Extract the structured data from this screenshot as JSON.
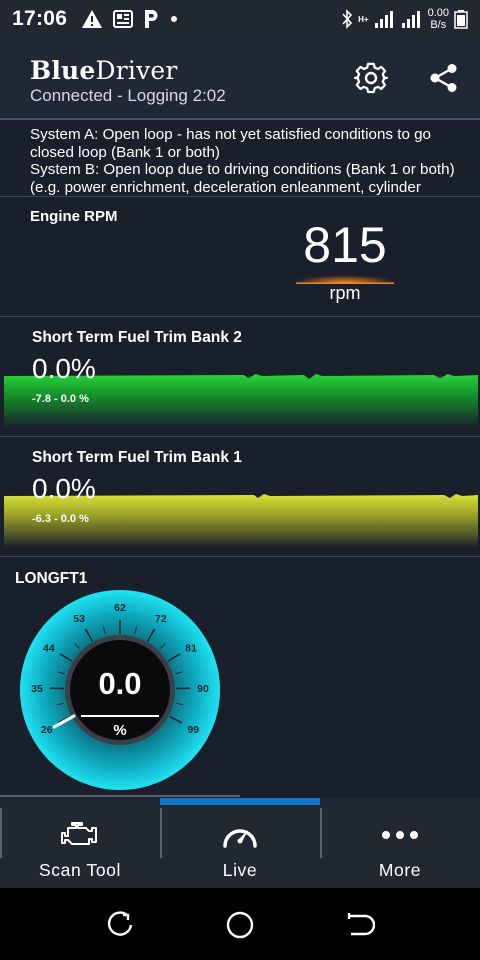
{
  "status_bar": {
    "time": "17:06",
    "left_icons": [
      "warning-icon",
      "news-icon",
      "parking-icon",
      "dot-icon"
    ],
    "network_label": "H+",
    "speed_value": "0.00",
    "speed_unit": "B/s"
  },
  "header": {
    "brand_bold": "Blue",
    "brand_rest": "Driver",
    "subtitle": "Connected - Logging 2:02",
    "settings_icon": "gear-icon",
    "share_icon": "share-icon"
  },
  "system_status": {
    "line_a": "System A: Open loop - has not yet satisfied conditions to go closed loop (Bank 1 or both)",
    "line_b": "System B: Open loop due to driving conditions (Bank 1 or both) (e.g. power enrichment, deceleration enleanment, cylinder"
  },
  "rpm": {
    "title": "Engine RPM",
    "value": "815",
    "unit": "rpm"
  },
  "fuel_trims": [
    {
      "title": "Short Term Fuel Trim Bank 2",
      "value": "0.0%",
      "range": "-7.8 - 0.0 %",
      "color": "#1ea82a"
    },
    {
      "title": "Short Term Fuel Trim Bank 1",
      "value": "0.0%",
      "range": "-6.3 - 0.0 %",
      "color": "#c7d22c"
    }
  ],
  "gauge": {
    "title": "LONGFT1",
    "value": "0.0",
    "unit": "%",
    "ticks": [
      "26",
      "35",
      "44",
      "53",
      "62",
      "72",
      "81",
      "90",
      "99"
    ],
    "accent": "#16d2e6"
  },
  "nav": {
    "items": [
      {
        "label": "Scan Tool",
        "icon": "engine-icon"
      },
      {
        "label": "Live",
        "icon": "speedometer-icon"
      },
      {
        "label": "More",
        "icon": "more-dots-icon"
      }
    ],
    "active_index": 1,
    "accent": "#1478c8"
  },
  "system_nav": {
    "recent_icon": "recent-apps-icon",
    "home_icon": "home-icon",
    "back_icon": "back-icon"
  }
}
